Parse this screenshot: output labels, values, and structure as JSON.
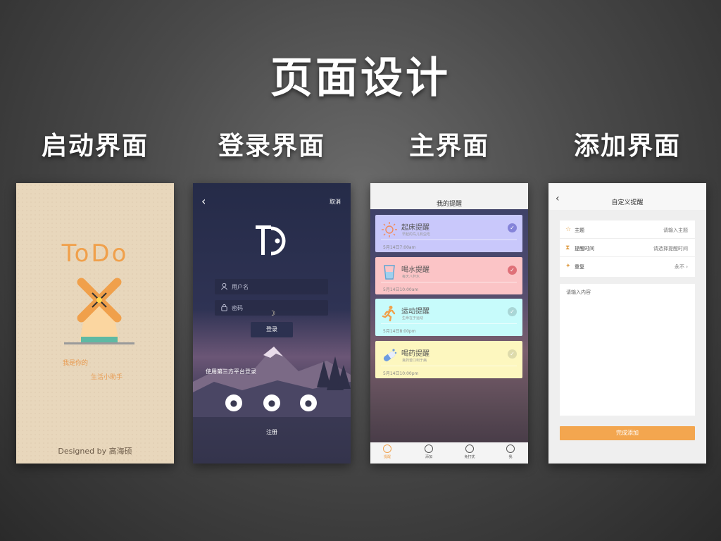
{
  "title": "页面设计",
  "sections": [
    {
      "label": "启动界面"
    },
    {
      "label": "登录界面"
    },
    {
      "label": "主界面"
    },
    {
      "label": "添加界面"
    }
  ],
  "splash": {
    "logo": "ToDo",
    "slogan_line1": "我是你的",
    "slogan_line2": "生活小助手",
    "credit": "Designed by 高海硕"
  },
  "login": {
    "back_icon": "chevron-left",
    "cancel": "取消",
    "username_placeholder": "用户名",
    "password_placeholder": "密码",
    "login_button": "登录",
    "third_party": "使用第三方平台登录",
    "register": "注册"
  },
  "main_screen": {
    "header": "我的提醒",
    "cards": [
      {
        "title": "起床提醒",
        "subtitle": "早起的鸟儿有虫吃",
        "time": "5月14日7:00am",
        "color": "#c9c8fb",
        "icon": "sun-icon"
      },
      {
        "title": "喝水提醒",
        "subtitle": "每天八杯水",
        "time": "5月14日10:00am",
        "color": "#fbc4c6",
        "icon": "cup-icon"
      },
      {
        "title": "运动提醒",
        "subtitle": "生命在于运动",
        "time": "5月14日8:00pm",
        "color": "#c7fbfb",
        "icon": "runner-icon"
      },
      {
        "title": "喝药提醒",
        "subtitle": "良药苦口利于病",
        "time": "5月14日10:00pm",
        "color": "#fdf7bf",
        "icon": "pill-icon"
      }
    ],
    "tabs": [
      {
        "label": "提醒",
        "active": true
      },
      {
        "label": "添加",
        "active": false
      },
      {
        "label": "免打扰",
        "active": false
      },
      {
        "label": "我",
        "active": false
      }
    ]
  },
  "add_screen": {
    "header": "自定义提醒",
    "rows": [
      {
        "label": "主题",
        "value": "请输入主题"
      },
      {
        "label": "提醒时间",
        "value": "请选择提醒时间"
      },
      {
        "label": "重复",
        "value": "永不"
      }
    ],
    "content_placeholder": "请输入内容",
    "submit": "完成添加"
  },
  "colors": {
    "accent": "#f0a04b",
    "submit": "#f3a64f"
  }
}
